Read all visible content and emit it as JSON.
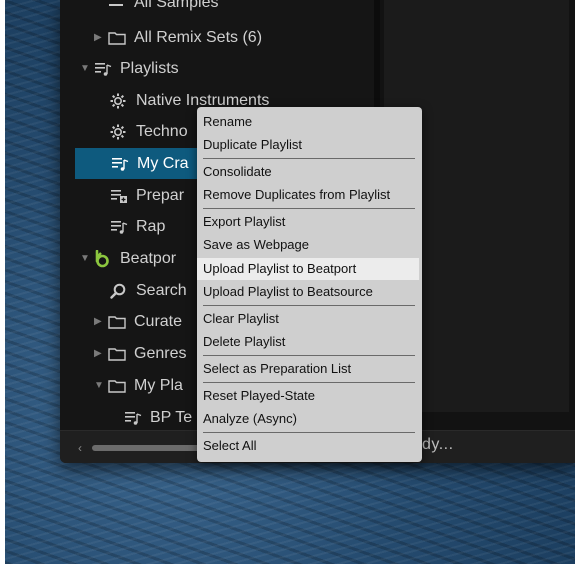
{
  "tree": {
    "items": [
      {
        "label": "All Samples",
        "icon": "samples-icon",
        "arrow": ""
      },
      {
        "label": "All Remix Sets (6)",
        "icon": "folder-icon",
        "arrow": "▶"
      },
      {
        "label": "Playlists",
        "icon": "playlist-icon",
        "arrow": "▼"
      },
      {
        "label": "Native Instruments",
        "icon": "gear-icon",
        "arrow": ""
      },
      {
        "label": "Techno",
        "icon": "gear-icon",
        "arrow": ""
      },
      {
        "label": "My Cra",
        "icon": "playlist-icon",
        "arrow": "",
        "selected": true
      },
      {
        "label": "Prepar",
        "icon": "preparation-list-icon",
        "arrow": ""
      },
      {
        "label": "Rap",
        "icon": "playlist-icon",
        "arrow": ""
      },
      {
        "label": "Beatpor",
        "icon": "beatport-icon",
        "arrow": "▼"
      },
      {
        "label": "Search",
        "icon": "search-icon",
        "arrow": ""
      },
      {
        "label": "Curate",
        "icon": "folder-icon",
        "arrow": "▶"
      },
      {
        "label": "Genres",
        "icon": "folder-icon",
        "arrow": "▶"
      },
      {
        "label": "My Pla",
        "icon": "folder-icon",
        "arrow": "▼"
      },
      {
        "label": "BP Te",
        "icon": "playlist-icon",
        "arrow": ""
      }
    ]
  },
  "status": {
    "text": "dy..."
  },
  "scrollbar": {
    "left_arrow": "‹"
  },
  "context_menu": {
    "items": [
      {
        "label": "Rename"
      },
      {
        "label": "Duplicate Playlist"
      },
      {
        "label": "Consolidate"
      },
      {
        "label": "Remove Duplicates from Playlist"
      },
      {
        "label": "Export Playlist"
      },
      {
        "label": "Save as Webpage"
      },
      {
        "label": "Upload Playlist to Beatport",
        "highlighted": true
      },
      {
        "label": "Upload Playlist to Beatsource"
      },
      {
        "label": "Clear Playlist"
      },
      {
        "label": "Delete Playlist"
      },
      {
        "label": "Select as Preparation List"
      },
      {
        "label": "Reset Played-State"
      },
      {
        "label": "Analyze (Async)"
      },
      {
        "label": "Select All"
      }
    ]
  },
  "colors": {
    "selection": "#0e5a7e",
    "beatport_accent": "#8cc63f",
    "menu_background": "#cfcfcf"
  }
}
